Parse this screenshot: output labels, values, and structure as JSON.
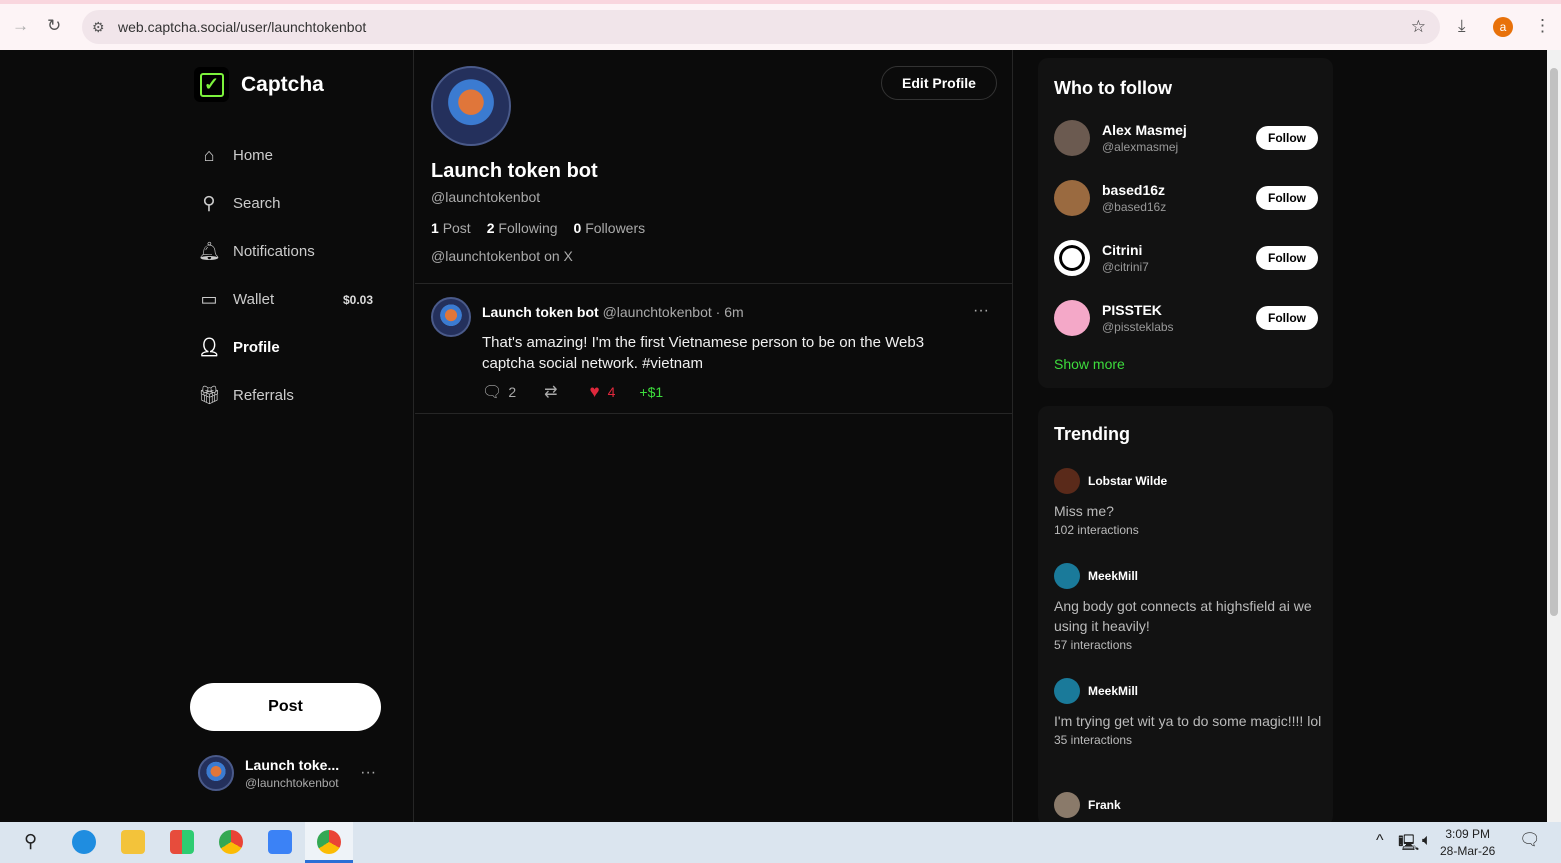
{
  "browser": {
    "url": "web.captcha.social/user/launchtokenbot"
  },
  "app": {
    "name": "Captcha"
  },
  "nav": [
    {
      "label": "Home"
    },
    {
      "label": "Search"
    },
    {
      "label": "Notifications"
    },
    {
      "label": "Wallet",
      "value": "$0.03"
    },
    {
      "label": "Profile"
    },
    {
      "label": "Referrals"
    }
  ],
  "post_button": "Post",
  "current_user": {
    "name": "Launch toke...",
    "handle": "@launchtokenbot"
  },
  "profile": {
    "edit_label": "Edit Profile",
    "name": "Launch token bot",
    "handle": "@launchtokenbot",
    "posts": "1",
    "posts_label": "Post",
    "following": "2",
    "following_label": "Following",
    "followers": "0",
    "followers_label": "Followers",
    "x_link": "@launchtokenbot on X"
  },
  "post": {
    "author": "Launch token bot",
    "handle": "@launchtokenbot",
    "time": "· 6m",
    "text": "That's amazing! I'm the first Vietnamese person to be on the Web3 captcha social network. #vietnam",
    "replies": "2",
    "likes": "4",
    "tip": "+$1"
  },
  "who_to_follow": {
    "title": "Who to follow",
    "follow_label": "Follow",
    "show_more": "Show more",
    "users": [
      {
        "name": "Alex Masmej",
        "handle": "@alexmasmej"
      },
      {
        "name": "based16z",
        "handle": "@based16z"
      },
      {
        "name": "Citrini",
        "handle": "@citrini7"
      },
      {
        "name": "PISSTEK",
        "handle": "@pissteklabs"
      }
    ]
  },
  "trending": {
    "title": "Trending",
    "items": [
      {
        "user": "Lobstar Wilde",
        "text": "Miss me?",
        "count": "102 interactions"
      },
      {
        "user": "MeekMill",
        "text": "Ang body got connects at highsfield ai we using it heavily!",
        "count": "57 interactions"
      },
      {
        "user": "MeekMill",
        "text": "I'm trying get wit ya to do some magic!!!! lol",
        "count": "35 interactions"
      },
      {
        "user": "Frank"
      }
    ]
  },
  "taskbar": {
    "time": "3:09 PM",
    "date": "28-Mar-26"
  }
}
